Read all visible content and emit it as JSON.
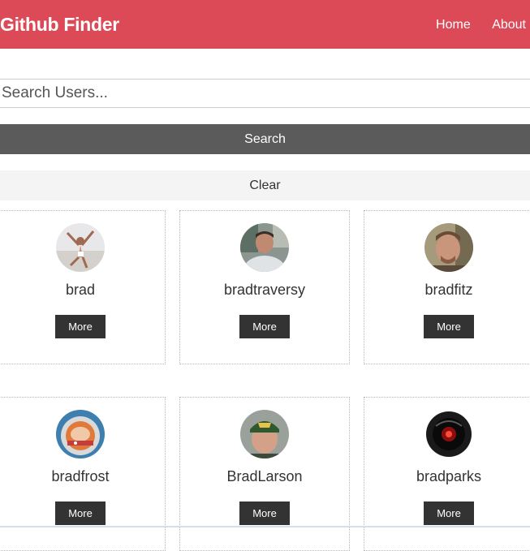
{
  "navbar": {
    "brand": "Github Finder",
    "links": [
      "Home",
      "About"
    ],
    "color": "#dc4a58"
  },
  "search": {
    "placeholder": "Search Users...",
    "value": "",
    "submit_label": "Search",
    "clear_label": "Clear"
  },
  "users": [
    {
      "login": "brad",
      "button": "More"
    },
    {
      "login": "bradtraversy",
      "button": "More"
    },
    {
      "login": "bradfitz",
      "button": "More"
    },
    {
      "login": "bradfrost",
      "button": "More"
    },
    {
      "login": "BradLarson",
      "button": "More"
    },
    {
      "login": "bradparks",
      "button": "More"
    }
  ]
}
